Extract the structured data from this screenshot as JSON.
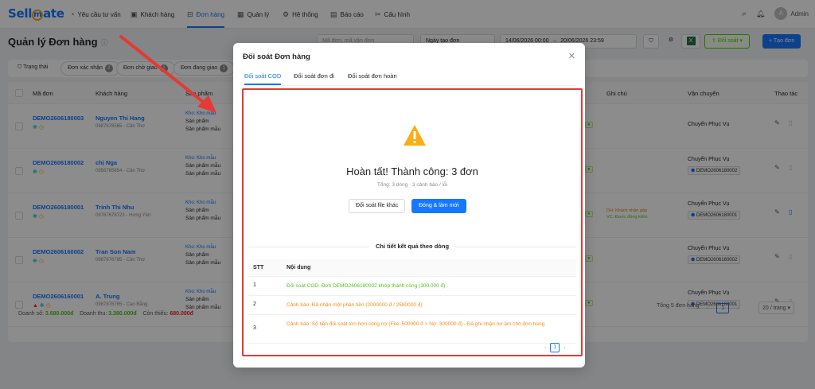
{
  "app": {
    "logo_pre": "Sell",
    "logo_mid": "m",
    "logo_post": "ate"
  },
  "nav": [
    {
      "label": "Yêu cầu tư vấn",
      "icon": "chat-icon",
      "glyph": "◔"
    },
    {
      "label": "Khách hàng",
      "icon": "user-card-icon",
      "glyph": "▣"
    },
    {
      "label": "Đơn hàng",
      "icon": "cart-icon",
      "glyph": "⊟"
    },
    {
      "label": "Quản lý",
      "icon": "grid-icon",
      "glyph": "▦"
    },
    {
      "label": "Hệ thống",
      "icon": "gear-icon",
      "glyph": "⚙"
    },
    {
      "label": "Báo cáo",
      "icon": "report-icon",
      "glyph": "▤"
    },
    {
      "label": "Cấu hình",
      "icon": "wrench-icon",
      "glyph": "✂"
    }
  ],
  "user": {
    "avatar": "A",
    "name": "Admin"
  },
  "page": {
    "title": "Quản lý Đơn hàng",
    "search_placeholder": "Mã đơn, mã vận đơn",
    "date_type": "Ngày tạo đơn",
    "date_from": "14/06/2026 00:00",
    "date_to": "20/06/2026 23:59",
    "export_label": "Đối soát",
    "create_label": "+ Tạo đơn"
  },
  "filters": [
    {
      "label": "Trạng thái",
      "count": ""
    },
    {
      "label": "Đơn xác nhận",
      "count": "2"
    },
    {
      "label": "Đơn chờ giao",
      "count": "2"
    },
    {
      "label": "Đơn đang giao",
      "count": "1"
    }
  ],
  "table": {
    "headers": [
      "Mã đơn",
      "Khách hàng",
      "Sản phẩm",
      "Ghi chú",
      "Vận chuyển",
      "Thao tác"
    ],
    "rows": [
      {
        "code": "DEMO2606180003",
        "customer": "Nguyen Thi Hang",
        "phone": "0987876565 - Cần Thơ",
        "warehouse": "Kho: Kho mẫu",
        "p1": "Sản phẩm",
        "p2": "Sản phẩm mẫu",
        "ship": "Chuyển Phục Vụ",
        "tracking": "",
        "note1": "",
        "note2": ""
      },
      {
        "code": "DEMO2606180002",
        "customer": "chị Nga",
        "phone": "0956765654 - Cần Thơ",
        "warehouse": "Kho: Kho mẫu",
        "p1": "Sản phẩm mẫu",
        "p2": "Sản phẩm mẫu",
        "ship": "Chuyển Phục Vụ",
        "tracking": "DEMO2606180002",
        "note1": "",
        "note2": ""
      },
      {
        "code": "DEMO2606180001",
        "customer": "Trinh Thi Nhu",
        "phone": "09787678723 - Hưng Yên",
        "warehouse": "Kho: Kho mẫu",
        "p1": "Sản phẩm",
        "p2": "Sản phẩm mẫu",
        "ship": "Chuyển Phục Vụ",
        "tracking": "DEMO2606180001",
        "note1": "DH: Khách nhận gấp",
        "note2": "VC: Được đồng kiểm"
      },
      {
        "code": "DEMO2606160002",
        "customer": "Tran Son Nam",
        "phone": "0987876785 - Cần Thơ",
        "warehouse": "Kho: Kho mẫu",
        "p1": "Sản phẩm",
        "p2": "Sản phẩm mẫu",
        "ship": "Chuyển Phục Vụ",
        "tracking": "DEMO2606160002",
        "note1": "",
        "note2": ""
      },
      {
        "code": "DEMO2606160001",
        "customer": "A. Trung",
        "phone": "0987876765 - Cao Bằng",
        "warehouse": "Kho: Kho mẫu",
        "p1": "Sản phẩm",
        "p2": "Sản phẩm mẫu",
        "ship": "Chuyển Phục Vụ",
        "tracking": "DEMO2606160001",
        "note1": "",
        "note2": ""
      }
    ]
  },
  "footer": {
    "sales_label": "Doanh số:",
    "sales": "3.680.000đ",
    "revenue_label": "Doanh thu:",
    "revenue": "3.380.000đ",
    "missing_label": "Còn thiếu:",
    "missing": "680.000đ",
    "total": "Tổng 5 đơn hàng",
    "page": "1",
    "page_size": "20 / trang"
  },
  "modal": {
    "title": "Đối soát Đơn hàng",
    "tabs": [
      "Đối soát COD",
      "Đối soát đơn đi",
      "Đối soát đơn hoàn"
    ],
    "result_title": "Hoàn tất! Thành công: 3 đơn",
    "result_sub": "Tổng: 3 dòng · 3 cảnh báo / lỗi",
    "btn_other": "Đối soát file khác",
    "btn_close": "Đóng & làm mới",
    "detail_title": "Chi tiết kết quả theo dòng",
    "col_stt": "STT",
    "col_content": "Nội dung",
    "results": [
      {
        "stt": "1",
        "text": "Đối soát COD: Đơn DEMO2606180002 khớp thành công (300.000 đ)",
        "kind": "ok"
      },
      {
        "stt": "2",
        "text": "Cảnh báo: Đã nhận một phần tiền (2000000 đ / 2580000 đ)",
        "kind": "warn"
      },
      {
        "stt": "3",
        "text": "Cảnh báo: Số tiền đối soát lớn hơn công nợ (File: 500000 đ > Nợ: 300000 đ) - Đã ghi nhận nợ âm cho đơn hàng",
        "kind": "warn"
      }
    ],
    "page": "1"
  },
  "colors": {
    "accent": "#1677ff",
    "success": "#52c41a",
    "warning": "#fa8c16",
    "highlight": "#e03c3c"
  }
}
